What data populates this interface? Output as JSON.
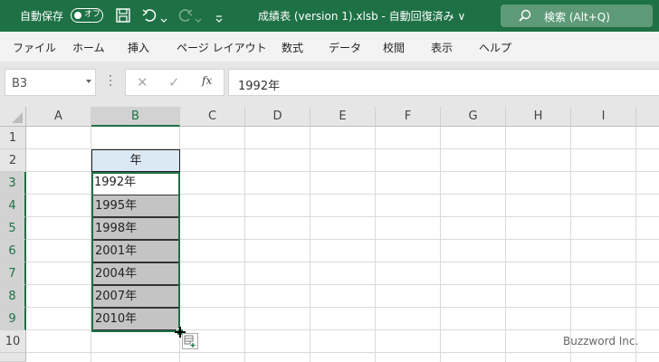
{
  "titlebar": {
    "autosave_label": "自動保存",
    "autosave_state": "オフ",
    "title": "成績表 (version 1).xlsb  -  自動回復済み  ∨",
    "search_placeholder": "検索 (Alt+Q)",
    "icons": [
      "save-icon",
      "undo-icon",
      "redo-icon",
      "customize-qat-icon",
      "search-icon"
    ]
  },
  "ribbon": {
    "tabs": [
      "ファイル",
      "ホーム",
      "挿入",
      "ページ レイアウト",
      "数式",
      "データ",
      "校閲",
      "表示",
      "ヘルプ"
    ]
  },
  "formula_bar": {
    "name_box": "B3",
    "fx_label": "fx",
    "cancel_symbol": "✕",
    "enter_symbol": "✓",
    "value": "1992年"
  },
  "sheet": {
    "columns": [
      "A",
      "B",
      "C",
      "D",
      "E",
      "F",
      "G",
      "H",
      "I"
    ],
    "rows": [
      "1",
      "2",
      "3",
      "4",
      "5",
      "6",
      "7",
      "8",
      "9",
      "10"
    ],
    "selected_column": "B",
    "selected_rows": [
      "3",
      "4",
      "5",
      "6",
      "7",
      "8",
      "9"
    ],
    "cells": {
      "B2": "年",
      "B3": "1992年",
      "B4": "1995年",
      "B5": "1998年",
      "B6": "2001年",
      "B7": "2004年",
      "B8": "2007年",
      "B9": "2010年"
    },
    "colors": {
      "accent": "#1e7145",
      "header_fill": "#dbe9f5",
      "selected_fill": "#c4c4c4"
    }
  },
  "watermark": "Buzzword Inc."
}
